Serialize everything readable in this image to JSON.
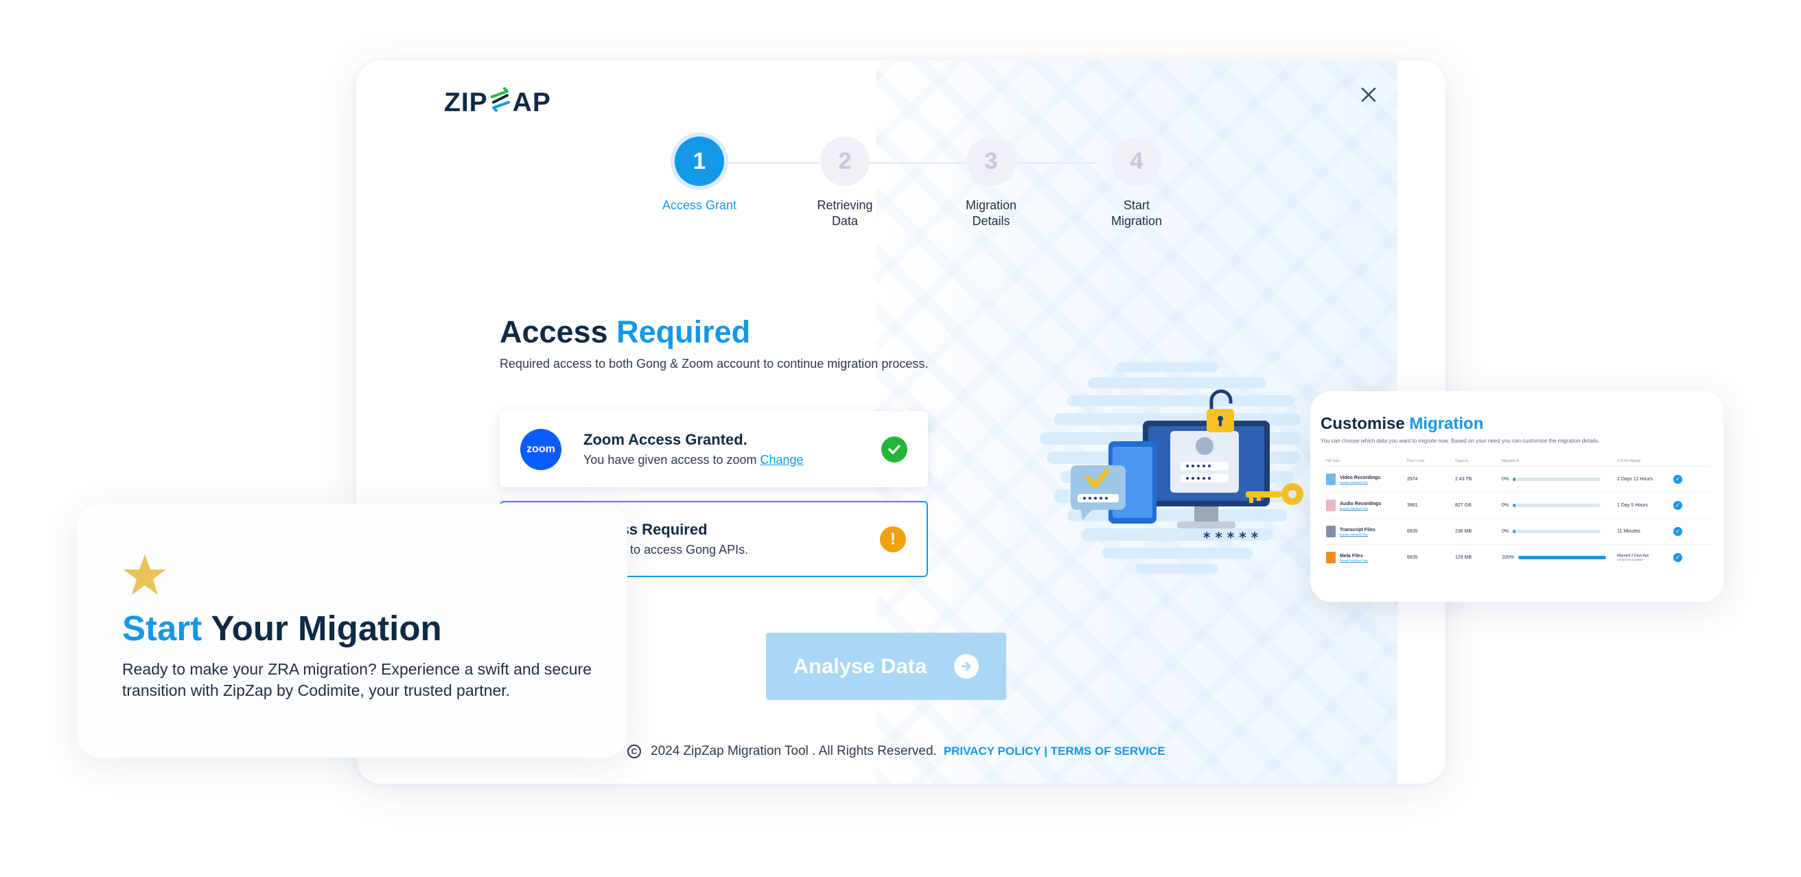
{
  "brand": {
    "logo_left": "ZIP",
    "logo_right": "AP"
  },
  "stepper": {
    "steps": [
      {
        "number": "1",
        "label": "Access Grant"
      },
      {
        "number": "2",
        "label": "Retrieving Data"
      },
      {
        "number": "3",
        "label": "Migration Details"
      },
      {
        "number": "4",
        "label": "Start Migration"
      }
    ],
    "active_step": 1
  },
  "access": {
    "title_main": "Access",
    "title_accent": "Required",
    "subtitle": "Required access to both Gong & Zoom account to continue migration process."
  },
  "zoom_card": {
    "logo_text": "zoom",
    "title": "Zoom Access Granted.",
    "desc": "You have given access to zoom",
    "link": "Change",
    "status": "granted"
  },
  "gong_card": {
    "title": "Access Required",
    "desc": "l details to access Gong APIs.",
    "status_icon": "!"
  },
  "actions": {
    "analyse_label": "Analyse Data"
  },
  "footer": {
    "copyright": "2024 ZipZap Migration Tool . All Rights Reserved.",
    "privacy": "PRIVACY POLICY",
    "separator": "|",
    "terms": "TERMS OF SERVICE"
  },
  "illustration": {
    "password_mask": "* * * * *"
  },
  "start_card": {
    "title_accent": "Start",
    "title_main": "Your Migation",
    "description": "Ready to make your ZRA migration? Experience a swift and secure transition with ZipZap by Codimite, your trusted partner."
  },
  "custom_card": {
    "title_main": "Customise",
    "title_accent": "Migration",
    "subtitle": "You can choose which data you want to migrate now. Based on your need you can customise the migration details.",
    "columns": [
      "File Type",
      "Files Count",
      "Capacity",
      "Migrated %",
      "ETA for Migrate",
      ""
    ],
    "rows": [
      {
        "name": "Video Recordings",
        "link": "Browse Individual Files",
        "count": "2974",
        "capacity": "2.43 TB",
        "percent": "0%",
        "progress": 0.03,
        "eta": "2 Days 12 Hours",
        "icon_color": "#6cb8ee"
      },
      {
        "name": "Audio Recordings",
        "link": "Browse Individual Files",
        "count": "3861",
        "capacity": "827 GB",
        "percent": "0%",
        "progress": 0.03,
        "eta": "1 Day 5 Hours",
        "icon_color": "#e9b6c7"
      },
      {
        "name": "Transcript Files",
        "link": "Browse Individual Files",
        "count": "6835",
        "capacity": "236 MB",
        "percent": "0%",
        "progress": 0.03,
        "eta": "11 Minutes",
        "icon_color": "#7f8da8"
      },
      {
        "name": "Meta Files",
        "link": "Browse Individual Files",
        "count": "6835",
        "capacity": "129 MB",
        "percent": "100%",
        "progress": 1.0,
        "eta": "Migrated 2 Days Ago",
        "eta_sub": "12/05/2024 12:33AM",
        "icon_color": "#f28c1e"
      }
    ]
  },
  "colors": {
    "accent": "#1597e8",
    "navy": "#0f2a44",
    "success": "#22b537",
    "warning": "#f2a20c",
    "star": "#e9c25a",
    "button_disabled": "#a9d7f5"
  }
}
